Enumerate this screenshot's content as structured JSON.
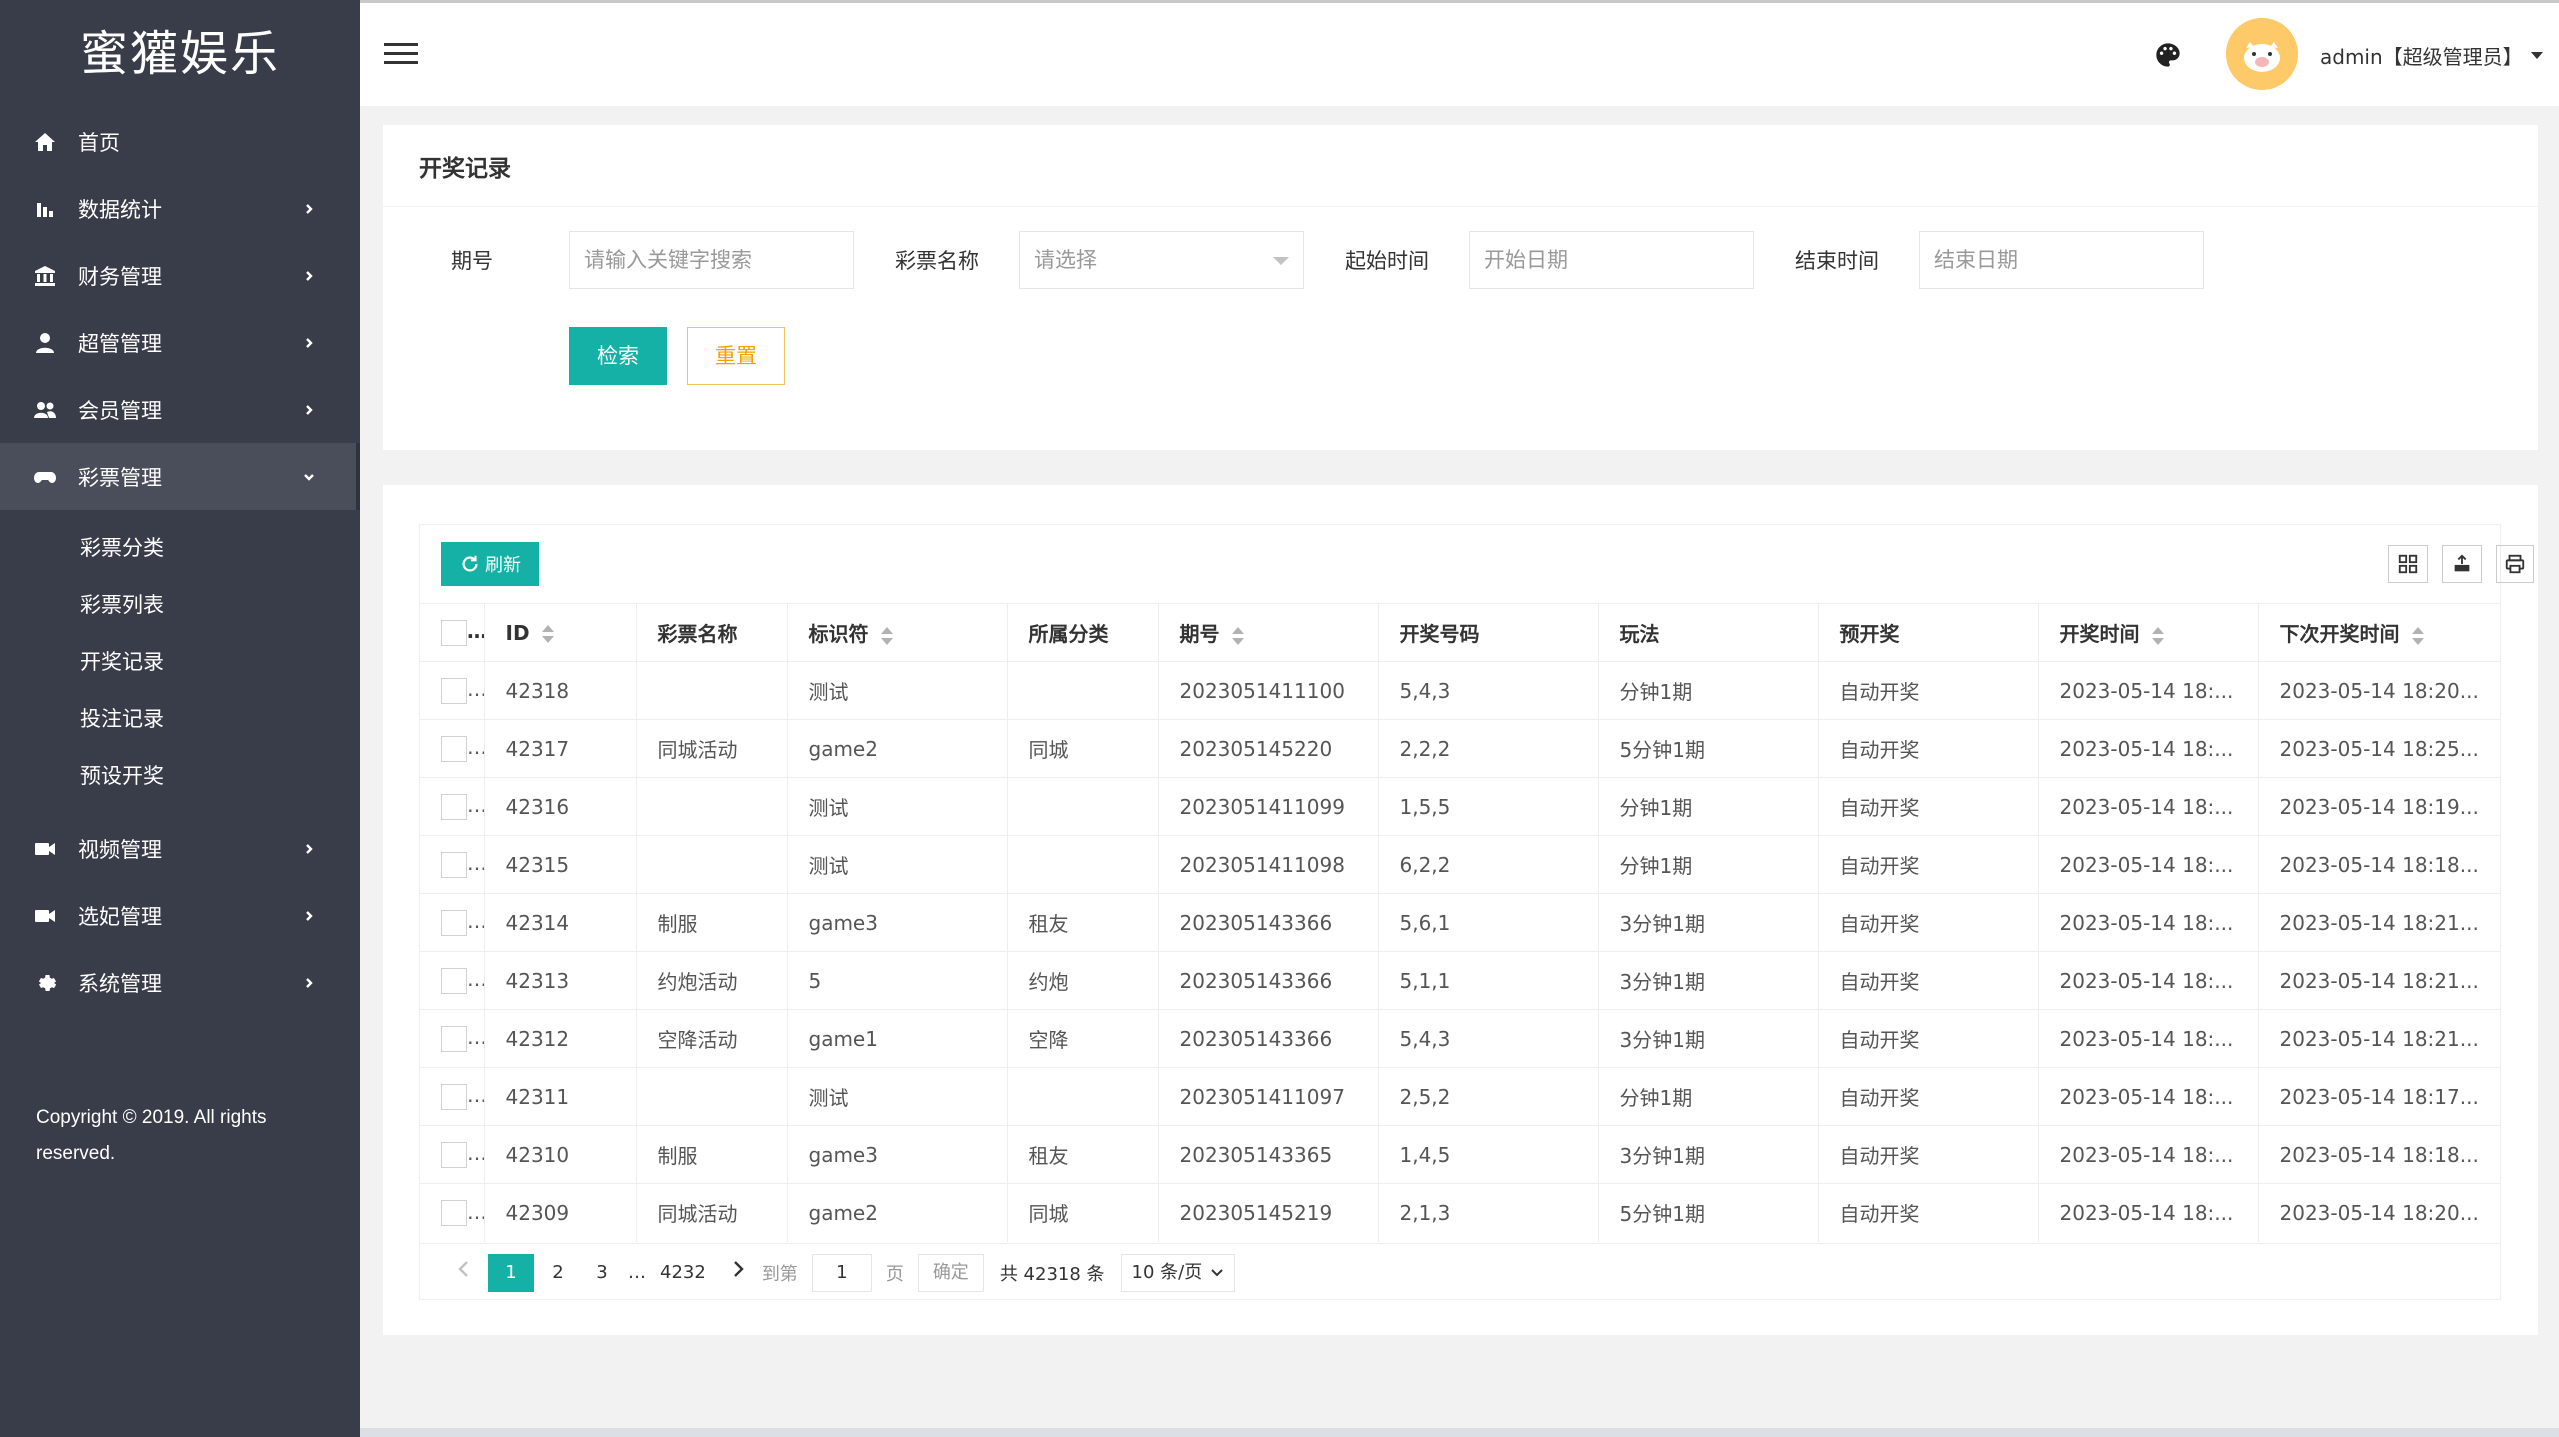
{
  "brand": "蜜獾娱乐",
  "sidebar": {
    "items": [
      {
        "label": "首页",
        "icon": "home-icon"
      },
      {
        "label": "数据统计",
        "icon": "bar-chart-icon"
      },
      {
        "label": "财务管理",
        "icon": "bank-icon"
      },
      {
        "label": "超管管理",
        "icon": "user-icon"
      },
      {
        "label": "会员管理",
        "icon": "users-icon"
      },
      {
        "label": "彩票管理",
        "icon": "gamepad-icon"
      },
      {
        "label": "视频管理",
        "icon": "video-icon"
      },
      {
        "label": "选妃管理",
        "icon": "video-icon"
      },
      {
        "label": "系统管理",
        "icon": "gear-icon"
      }
    ],
    "submenu": [
      "彩票分类",
      "彩票列表",
      "开奖记录",
      "投注记录",
      "预设开奖"
    ],
    "copyright": "Copyright © 2019. All rights reserved."
  },
  "header": {
    "user": "admin【超级管理员】"
  },
  "search": {
    "title": "开奖记录",
    "labels": {
      "issue": "期号",
      "lottery_name": "彩票名称",
      "start_time": "起始时间",
      "end_time": "结束时间"
    },
    "placeholders": {
      "issue": "请输入关键字搜索",
      "lottery_name": "请选择",
      "start_time": "开始日期",
      "end_time": "结束日期"
    },
    "search_button": "检索",
    "reset_button": "重置"
  },
  "table": {
    "refresh_label": "刷新",
    "columns": [
      "ID",
      "彩票名称",
      "标识符",
      "所属分类",
      "期号",
      "开奖号码",
      "玩法",
      "预开奖",
      "开奖时间",
      "下次开奖时间"
    ],
    "rows": [
      [
        "42318",
        "",
        "测试",
        "",
        "2023051411100",
        "5,4,3",
        "分钟1期",
        "自动开奖",
        "2023-05-14 18:...",
        "2023-05-14 18:20..."
      ],
      [
        "42317",
        "同城活动",
        "game2",
        "同城",
        "202305145220",
        "2,2,2",
        "5分钟1期",
        "自动开奖",
        "2023-05-14 18:...",
        "2023-05-14 18:25..."
      ],
      [
        "42316",
        "",
        "测试",
        "",
        "2023051411099",
        "1,5,5",
        "分钟1期",
        "自动开奖",
        "2023-05-14 18:...",
        "2023-05-14 18:19..."
      ],
      [
        "42315",
        "",
        "测试",
        "",
        "2023051411098",
        "6,2,2",
        "分钟1期",
        "自动开奖",
        "2023-05-14 18:...",
        "2023-05-14 18:18..."
      ],
      [
        "42314",
        "制服",
        "game3",
        "租友",
        "202305143366",
        "5,6,1",
        "3分钟1期",
        "自动开奖",
        "2023-05-14 18:...",
        "2023-05-14 18:21..."
      ],
      [
        "42313",
        "约炮活动",
        "5",
        "约炮",
        "202305143366",
        "5,1,1",
        "3分钟1期",
        "自动开奖",
        "2023-05-14 18:...",
        "2023-05-14 18:21..."
      ],
      [
        "42312",
        "空降活动",
        "game1",
        "空降",
        "202305143366",
        "5,4,3",
        "3分钟1期",
        "自动开奖",
        "2023-05-14 18:...",
        "2023-05-14 18:21..."
      ],
      [
        "42311",
        "",
        "测试",
        "",
        "2023051411097",
        "2,5,2",
        "分钟1期",
        "自动开奖",
        "2023-05-14 18:...",
        "2023-05-14 18:17..."
      ],
      [
        "42310",
        "制服",
        "game3",
        "租友",
        "202305143365",
        "1,4,5",
        "3分钟1期",
        "自动开奖",
        "2023-05-14 18:...",
        "2023-05-14 18:18..."
      ],
      [
        "42309",
        "同城活动",
        "game2",
        "同城",
        "202305145219",
        "2,1,3",
        "5分钟1期",
        "自动开奖",
        "2023-05-14 18:...",
        "2023-05-14 18:20..."
      ]
    ]
  },
  "pagination": {
    "pages": [
      "1",
      "2",
      "3",
      "…",
      "4232"
    ],
    "goto_label": "到第",
    "goto_value": "1",
    "page_unit": "页",
    "confirm": "确定",
    "total": "共 42318 条",
    "page_size": "10 条/页"
  },
  "colors": {
    "sidebar_bg": "#393d49",
    "accent": "#16b1a6",
    "reset": "#f2a000"
  }
}
